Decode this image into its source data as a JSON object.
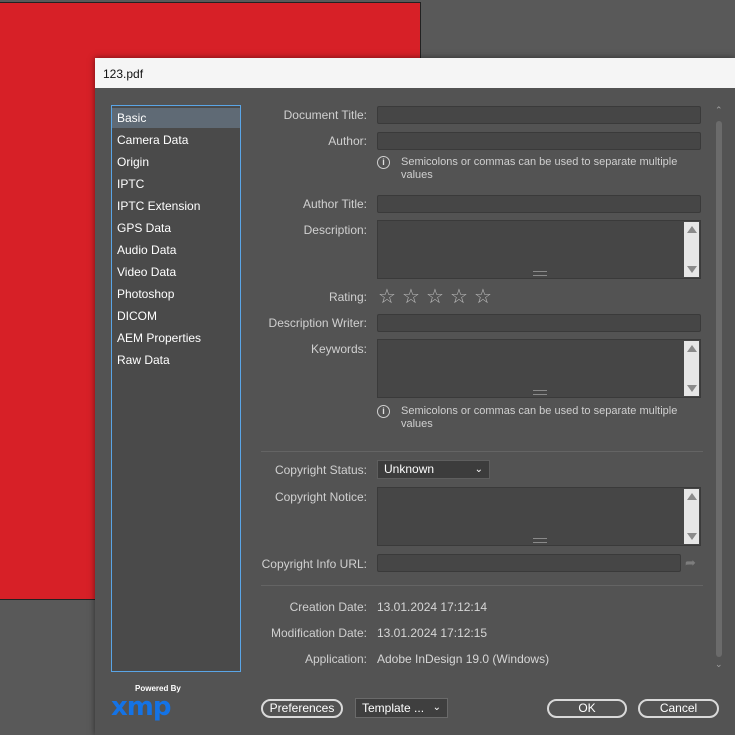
{
  "dialog": {
    "title": "123.pdf"
  },
  "sidebar": {
    "items": [
      {
        "label": "Basic",
        "active": true
      },
      {
        "label": "Camera Data"
      },
      {
        "label": "Origin"
      },
      {
        "label": "IPTC"
      },
      {
        "label": "IPTC Extension"
      },
      {
        "label": "GPS Data"
      },
      {
        "label": "Audio Data"
      },
      {
        "label": "Video Data"
      },
      {
        "label": "Photoshop"
      },
      {
        "label": "DICOM"
      },
      {
        "label": "AEM Properties"
      },
      {
        "label": "Raw Data"
      }
    ]
  },
  "form": {
    "document_title": {
      "label": "Document Title:",
      "value": ""
    },
    "author": {
      "label": "Author:",
      "value": ""
    },
    "author_hint": "Semicolons or commas can be used to separate multiple values",
    "author_title": {
      "label": "Author Title:",
      "value": ""
    },
    "description": {
      "label": "Description:",
      "value": ""
    },
    "rating": {
      "label": "Rating:",
      "value": 0,
      "max": 5
    },
    "description_writer": {
      "label": "Description Writer:",
      "value": ""
    },
    "keywords": {
      "label": "Keywords:",
      "value": ""
    },
    "keywords_hint": "Semicolons or commas can be used to separate multiple values",
    "copyright_status": {
      "label": "Copyright Status:",
      "value": "Unknown"
    },
    "copyright_notice": {
      "label": "Copyright Notice:",
      "value": ""
    },
    "copyright_url": {
      "label": "Copyright Info URL:",
      "value": ""
    },
    "creation_date": {
      "label": "Creation Date:",
      "value": "13.01.2024 17:12:14"
    },
    "modification_date": {
      "label": "Modification Date:",
      "value": "13.01.2024 17:12:15"
    },
    "application": {
      "label": "Application:",
      "value": "Adobe InDesign 19.0 (Windows)"
    }
  },
  "footer": {
    "powered_by": "Powered By",
    "logo_text": "xmp",
    "preferences_label": "Preferences",
    "template_label": "Template ...",
    "ok_label": "OK",
    "cancel_label": "Cancel"
  },
  "icons": {
    "info": "info-icon",
    "star": "star-outline-icon",
    "share": "share-arrow-icon",
    "chevron": "chevron-down-icon"
  },
  "colors": {
    "canvas": "#d72027",
    "dialog_bg": "#535353",
    "sidebar_border": "#5aa5e6",
    "xmp_logo": "#1473e6"
  }
}
